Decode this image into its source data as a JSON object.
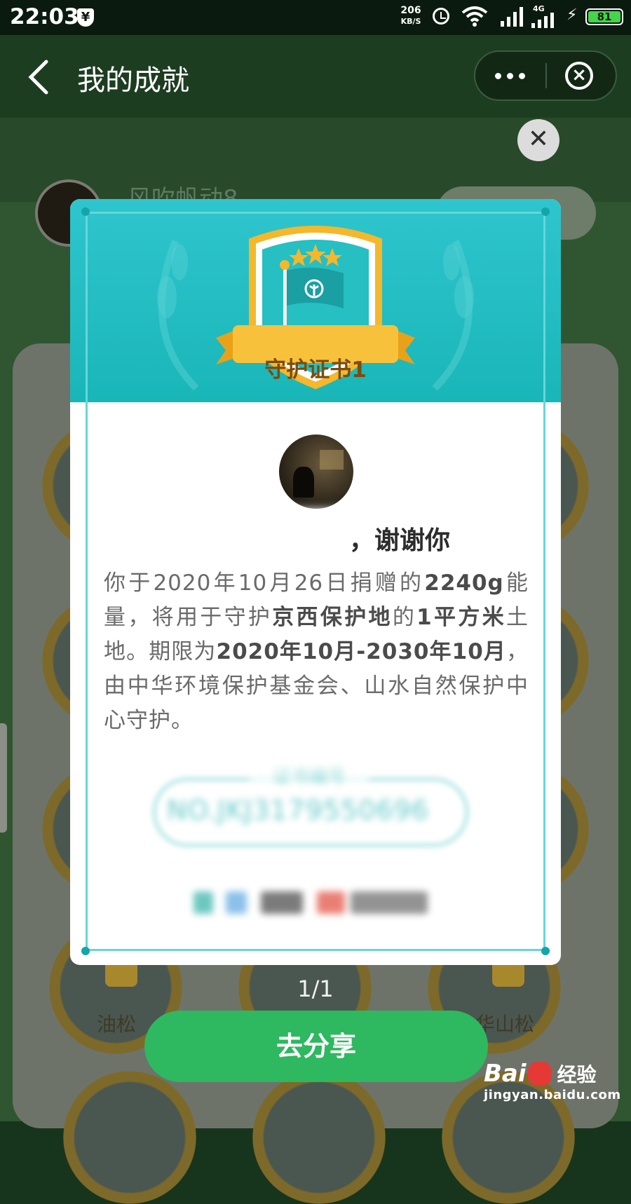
{
  "status_bar": {
    "time": "22:03",
    "net_speed_value": "206",
    "net_speed_unit": "KB/S",
    "network_type": "4G",
    "battery": "81"
  },
  "nav": {
    "title": "我的成就"
  },
  "background": {
    "user_name": "风吹帆动8",
    "badge_labels": [
      "油松",
      "华山松"
    ]
  },
  "certificate": {
    "ribbon_title": "守护证书1",
    "thanks": "，谢谢你",
    "body": {
      "p1": "你于2020年10月26日捐赠的",
      "energy": "2240g",
      "p2": "能量，将用于守护",
      "area_name": "京西保护地",
      "p3": "的",
      "area_size": "1平方米",
      "p4": "土地。期限为",
      "period": "2020年10月-2030年10月",
      "p5": "，由中华环境保护基金会、山水自然保护中心守护。"
    },
    "cert_no_label": "证书编号",
    "cert_no": "NO.JKJ3179550696"
  },
  "pager": "1/1",
  "share_button": "去分享",
  "watermark": {
    "brand_left": "Bai",
    "brand_right": "经验",
    "url": "jingyan.baidu.com"
  },
  "colors": {
    "teal": "#1fbabd",
    "share_green": "#2eb85f",
    "gold": "#f5b72b"
  }
}
